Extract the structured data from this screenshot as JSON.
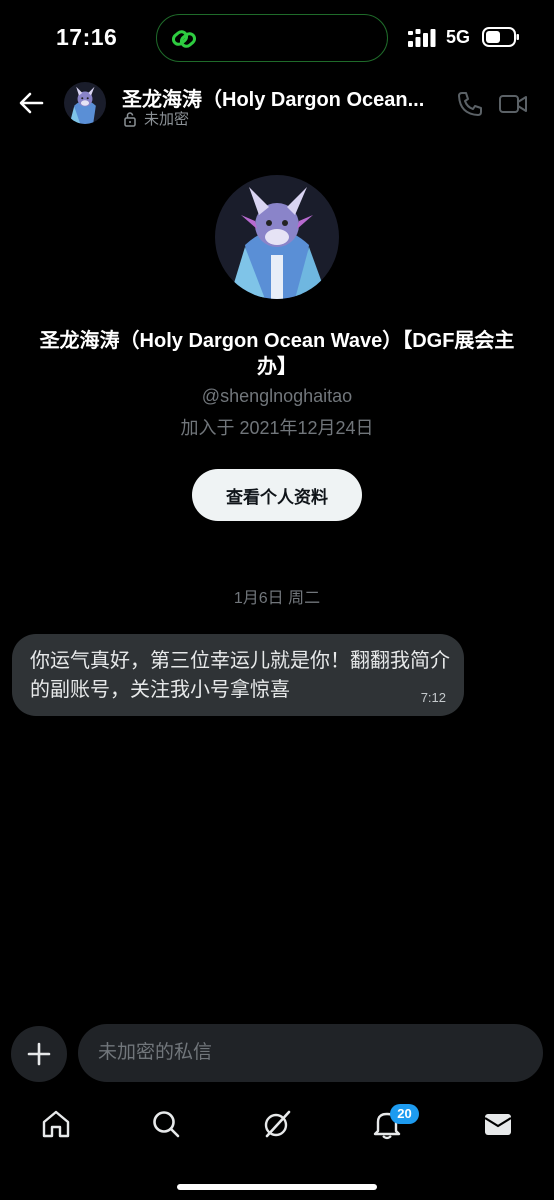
{
  "status_bar": {
    "time": "17:16",
    "network": "5G",
    "icons": [
      "link-icon",
      "signal-icon",
      "battery-icon"
    ],
    "island_accent": "#2ecc40"
  },
  "header": {
    "name": "圣龙海涛（Holy Dargon Ocean...",
    "encryption_status": "未加密",
    "icons": [
      "back-arrow-icon",
      "lock-open-icon",
      "phone-icon",
      "video-icon"
    ]
  },
  "profile": {
    "name": "圣龙海涛（Holy Dargon Ocean Wave）【DGF展会主办】",
    "handle": "@shenglnoghaitao",
    "joined": "加入于 2021年12月24日",
    "view_profile_label": "查看个人资料"
  },
  "conversation": {
    "date_separator": "1月6日 周二",
    "messages": [
      {
        "text": "你运气真好，第三位幸运儿就是你！翻翻我简介的副账号，关注我小号拿惊喜",
        "time": "7:12"
      }
    ]
  },
  "composer": {
    "placeholder": "未加密的私信",
    "add_icon": "plus-icon"
  },
  "tab_bar": {
    "items": [
      "home-icon",
      "search-icon",
      "grok-icon",
      "notifications-icon",
      "messages-icon"
    ],
    "notifications_badge": "20"
  },
  "colors": {
    "background": "#000000",
    "bubble": "#2f3336",
    "muted_text": "#71767b",
    "badge": "#1d9bf0",
    "button_bg": "#eff3f4"
  }
}
